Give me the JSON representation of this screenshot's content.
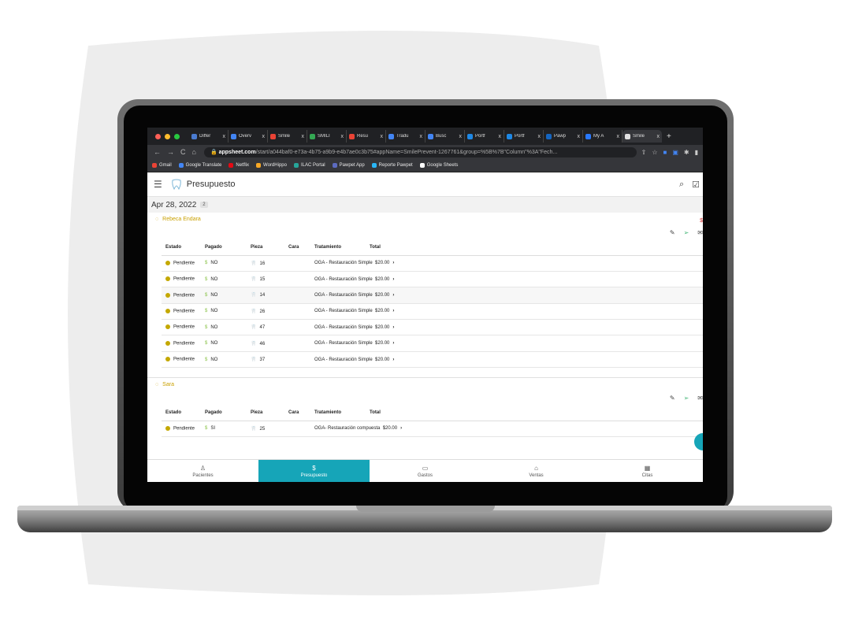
{
  "browser": {
    "tabs": [
      {
        "label": "Differ",
        "color": "#4a7bd0"
      },
      {
        "label": "Overv",
        "color": "#4285f4"
      },
      {
        "label": "Smile",
        "color": "#ea4335"
      },
      {
        "label": "SMILI",
        "color": "#34a853"
      },
      {
        "label": "Resu",
        "color": "#ea4335"
      },
      {
        "label": "Tradu",
        "color": "#4285f4"
      },
      {
        "label": "Busc",
        "color": "#4285f4"
      },
      {
        "label": "Portf",
        "color": "#1e88e5"
      },
      {
        "label": "Portf",
        "color": "#1e88e5"
      },
      {
        "label": "Pawp",
        "color": "#1565c0"
      },
      {
        "label": "My A",
        "color": "#2979ff"
      },
      {
        "label": "Smile",
        "color": "#e0e0e0",
        "active": true
      }
    ],
    "tab_close": "x",
    "new_tab": "+",
    "back": "←",
    "forward": "→",
    "reload": "C",
    "home": "⌂",
    "url_domain": "appsheet.com",
    "url_path": "/start/a044baf0-e73a-4b75-a9b9-e4b7ae0c3b75#appName=SmilePrevent-1267761&group=%5B%7B\"Column\"%3A\"Fech...",
    "bookmarks": [
      {
        "label": "Gmail",
        "color": "#ea4335"
      },
      {
        "label": "Google Translate",
        "color": "#4285f4"
      },
      {
        "label": "Netflix",
        "color": "#e50914"
      },
      {
        "label": "WordHippo",
        "color": "#f9a825"
      },
      {
        "label": "ILAC Portal",
        "color": "#26a69a"
      },
      {
        "label": "Pawpet App",
        "color": "#5c6bc0"
      },
      {
        "label": "Reporte Pawpet",
        "color": "#29b6f6"
      },
      {
        "label": "Google Sheets",
        "color": "#ffffff"
      }
    ]
  },
  "app": {
    "title": "Presupuesto",
    "overflow_tag": "$"
  },
  "group": {
    "date": "Apr 28, 2022",
    "count": "2"
  },
  "columns": [
    "Estado",
    "Pagado",
    "Pieza",
    "Cara",
    "Tratamiento",
    "Total"
  ],
  "clients": [
    {
      "name": "Rebeca Endara",
      "rows": [
        {
          "estado": "Pendiente",
          "pagado": "NO",
          "pieza": "16",
          "cara": "",
          "tratamiento": "OGA - Restauración Simple",
          "total": "$20.00"
        },
        {
          "estado": "Pendiente",
          "pagado": "NO",
          "pieza": "15",
          "cara": "",
          "tratamiento": "OGA - Restauración Simple",
          "total": "$20.00"
        },
        {
          "estado": "Pendiente",
          "pagado": "NO",
          "pieza": "14",
          "cara": "",
          "tratamiento": "OGA - Restauración Simple",
          "total": "$20.00"
        },
        {
          "estado": "Pendiente",
          "pagado": "NO",
          "pieza": "26",
          "cara": "",
          "tratamiento": "OGA - Restauración Simple",
          "total": "$20.00"
        },
        {
          "estado": "Pendiente",
          "pagado": "NO",
          "pieza": "47",
          "cara": "",
          "tratamiento": "OGA - Restauración Simple",
          "total": "$20.00"
        },
        {
          "estado": "Pendiente",
          "pagado": "NO",
          "pieza": "46",
          "cara": "",
          "tratamiento": "OGA - Restauración Simple",
          "total": "$20.00"
        },
        {
          "estado": "Pendiente",
          "pagado": "NO",
          "pieza": "37",
          "cara": "",
          "tratamiento": "OGA - Restauración Simple",
          "total": "$20.00"
        }
      ]
    },
    {
      "name": "Sara",
      "rows": [
        {
          "estado": "Pendiente",
          "pagado": "SI",
          "pieza": "25",
          "cara": "",
          "tratamiento": "OGA- Restauración compuesta",
          "total": "$20.00"
        }
      ]
    }
  ],
  "nav": [
    {
      "label": "Pacientes",
      "icon": "person-icon",
      "glyph": "♙"
    },
    {
      "label": "Presupuesto",
      "icon": "dollar-icon",
      "glyph": "$",
      "active": true
    },
    {
      "label": "Gastos",
      "icon": "wallet-icon",
      "glyph": "▭"
    },
    {
      "label": "Ventas",
      "icon": "cash-register-icon",
      "glyph": "⌂"
    },
    {
      "label": "Citas",
      "icon": "calendar-icon",
      "glyph": "▦"
    }
  ],
  "colors": {
    "accent": "#16a5b8",
    "status_pending": "#c4a800",
    "client_name": "#c9a000",
    "tooth": "#d32f2f",
    "dollar": "#8bc34a"
  }
}
